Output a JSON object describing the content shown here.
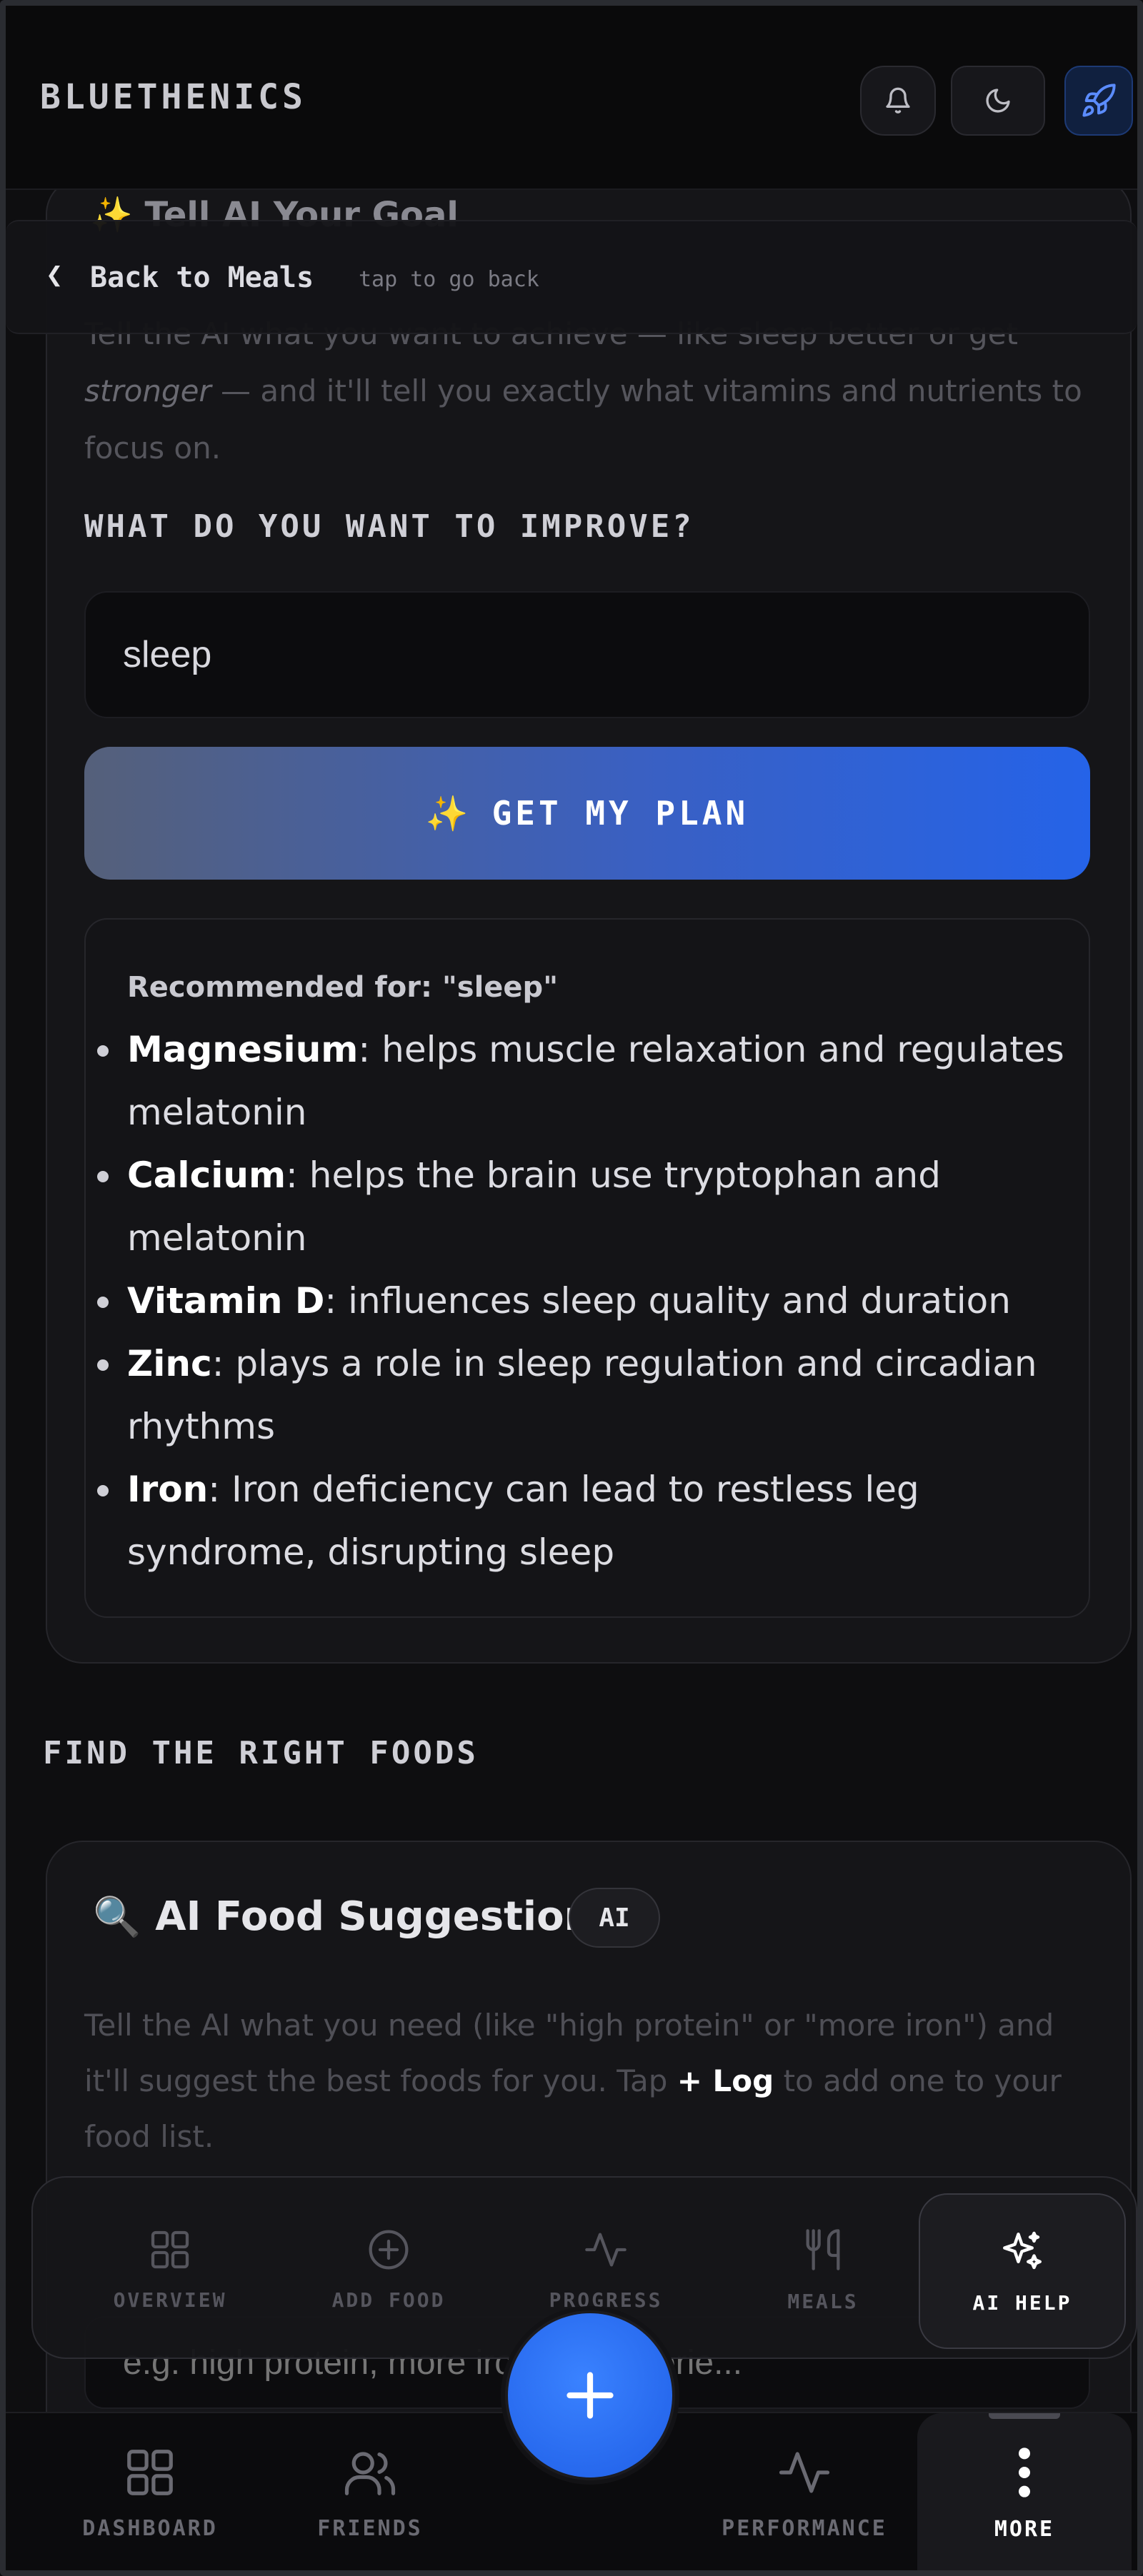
{
  "header": {
    "brand": "BLUETHENICS"
  },
  "back_bar": {
    "label": "Back to Meals",
    "hint": "tap to go back"
  },
  "goal_card": {
    "peek_title": "✨ Tell AI Your Goal",
    "intro_before_em": "Tell the AI what you want to achieve — like sleep better or get ",
    "intro_em": "stronger",
    "intro_after_em": " — and it'll tell you exactly what vitamins and nutrients to focus on.",
    "question_label": "WHAT DO YOU WANT TO IMPROVE?",
    "input_value": "sleep",
    "button_icon": "✨",
    "button_label": "GET MY PLAN",
    "result": {
      "recommended_for": "Recommended for: \"sleep\"",
      "items": [
        {
          "name": "Magnesium",
          "desc": ": helps muscle relaxation and regulates melatonin"
        },
        {
          "name": "Calcium",
          "desc": ": helps the brain use tryptophan and melatonin"
        },
        {
          "name": "Vitamin D",
          "desc": ": influences sleep quality and duration"
        },
        {
          "name": "Zinc",
          "desc": ": plays a role in sleep regulation and circadian rhythms"
        },
        {
          "name": "Iron",
          "desc": ": Iron deficiency can lead to restless leg syndrome, disrupting sleep"
        }
      ]
    }
  },
  "section": {
    "title": "FIND THE RIGHT FOODS"
  },
  "food_card": {
    "icon": "🔍",
    "title": "AI Food Suggestions",
    "badge": "AI",
    "desc_before": "Tell the AI what you need (like \"high protein\" or \"more iron\") and it'll suggest the best foods for you. Tap ",
    "desc_bold": "+ Log",
    "desc_after": " to add one to your food list.",
    "input_placeholder": "e.g. high protein, more iron, low calorie..."
  },
  "sub_nav": {
    "items": [
      {
        "label": "OVERVIEW",
        "icon": "grid-icon"
      },
      {
        "label": "ADD FOOD",
        "icon": "plus-circle-icon"
      },
      {
        "label": "PROGRESS",
        "icon": "activity-icon"
      },
      {
        "label": "MEALS",
        "icon": "utensils-icon"
      },
      {
        "label": "AI HELP",
        "icon": "sparkles-icon"
      }
    ],
    "active": "AI HELP"
  },
  "bottom_nav": {
    "items": [
      {
        "label": "DASHBOARD",
        "icon": "grid-icon"
      },
      {
        "label": "FRIENDS",
        "icon": "users-icon"
      },
      {
        "label": "PERFORMANCE",
        "icon": "activity-icon"
      },
      {
        "label": "MORE",
        "icon": "more-vertical-icon"
      }
    ],
    "active": "MORE",
    "fab_icon": "plus-icon"
  },
  "colors": {
    "accent": "#2563e8",
    "background": "#0e0e10",
    "card": "#151518"
  }
}
